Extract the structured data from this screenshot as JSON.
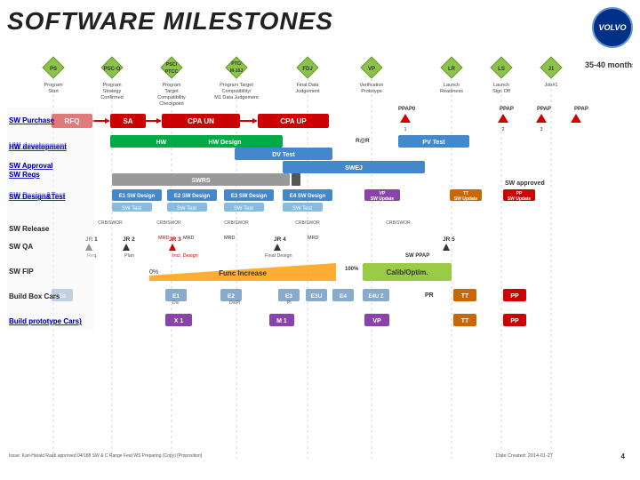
{
  "header": {
    "title": "SOFTWARE MILESTONES",
    "months": "35-40 months",
    "logo": "VOLVO"
  },
  "milestones": [
    {
      "id": "PS",
      "label": "PS",
      "sublabel": "Program Start",
      "color": "#a0c060"
    },
    {
      "id": "PSC-O",
      "label": "PSC-O",
      "sublabel": "Program Strategy Confirmed",
      "color": "#a0c060"
    },
    {
      "id": "PSCI-PTCC",
      "label": "PSC/ PTCC",
      "sublabel": "Program Target Compatibility Checkpoint",
      "color": "#a0c060"
    },
    {
      "id": "PTCJ-M10J",
      "label": "PTC/ M-10 J",
      "sublabel": "Program Target Compatibility/ M1 Data Judgement",
      "color": "#a0c060"
    },
    {
      "id": "FDJ",
      "label": "FDJ",
      "sublabel": "Final Data Judgement",
      "color": "#a0c060"
    },
    {
      "id": "VP",
      "label": "VP",
      "sublabel": "Verification Prototype",
      "color": "#a0c060"
    },
    {
      "id": "LR",
      "label": "LR",
      "sublabel": "Launch Readiness",
      "color": "#a0c060"
    },
    {
      "id": "LS",
      "label": "LS",
      "sublabel": "Launch Sign Off",
      "color": "#a0c060"
    },
    {
      "id": "J1",
      "label": "J1",
      "sublabel": "Job#1",
      "color": "#a0c060"
    }
  ],
  "rows": [
    {
      "label": "SW Purchase",
      "type": "purchase"
    },
    {
      "label": "HW development",
      "type": "hw"
    },
    {
      "label": "SW Approval SW Reqs",
      "type": "swapproval"
    },
    {
      "label": "SW Design&Test",
      "type": "swdesign"
    },
    {
      "label": "SW Release",
      "type": "swrelease"
    },
    {
      "label": "SW QA",
      "type": "swqa"
    },
    {
      "label": "SW FIP",
      "type": "swfip"
    },
    {
      "label": "Build Box Cars",
      "type": "buildbox"
    },
    {
      "label": "Build prototype Cars)",
      "type": "buildproto"
    }
  ],
  "footer": {
    "source": "Issue: Karl-Harald Raab approved 04/188  SW & C Range Feat WS  Preparing (Copy) [Proposition]",
    "date": "Date Created: 2014-01-27"
  }
}
